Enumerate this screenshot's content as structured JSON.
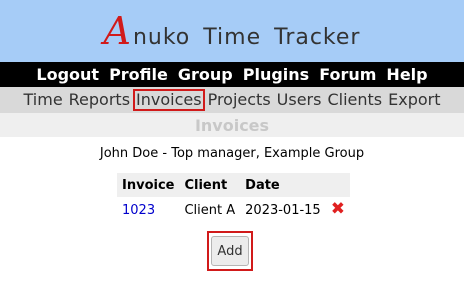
{
  "header": {
    "logo_letter": "A",
    "logo_rest": "nuko",
    "logo_word2": "Time",
    "logo_word3": "Tracker",
    "colors": {
      "header_bg": "#a6ccf7",
      "logo_accent": "#d11a1a"
    }
  },
  "top_menu": [
    {
      "label": "Logout"
    },
    {
      "label": "Profile"
    },
    {
      "label": "Group"
    },
    {
      "label": "Plugins"
    },
    {
      "label": "Forum"
    },
    {
      "label": "Help"
    }
  ],
  "sub_menu": [
    {
      "label": "Time",
      "active": false
    },
    {
      "label": "Reports",
      "active": false
    },
    {
      "label": "Invoices",
      "active": true
    },
    {
      "label": "Projects",
      "active": false
    },
    {
      "label": "Users",
      "active": false
    },
    {
      "label": "Clients",
      "active": false
    },
    {
      "label": "Export",
      "active": false
    }
  ],
  "page": {
    "title": "Invoices",
    "user_line": "John Doe - Top manager, Example Group"
  },
  "table": {
    "headers": [
      "Invoice",
      "Client",
      "Date"
    ],
    "rows": [
      {
        "invoice": "1023",
        "client": "Client A",
        "date": "2023-01-15",
        "delete_icon": "delete-x-icon"
      }
    ]
  },
  "actions": {
    "add_label": "Add"
  }
}
